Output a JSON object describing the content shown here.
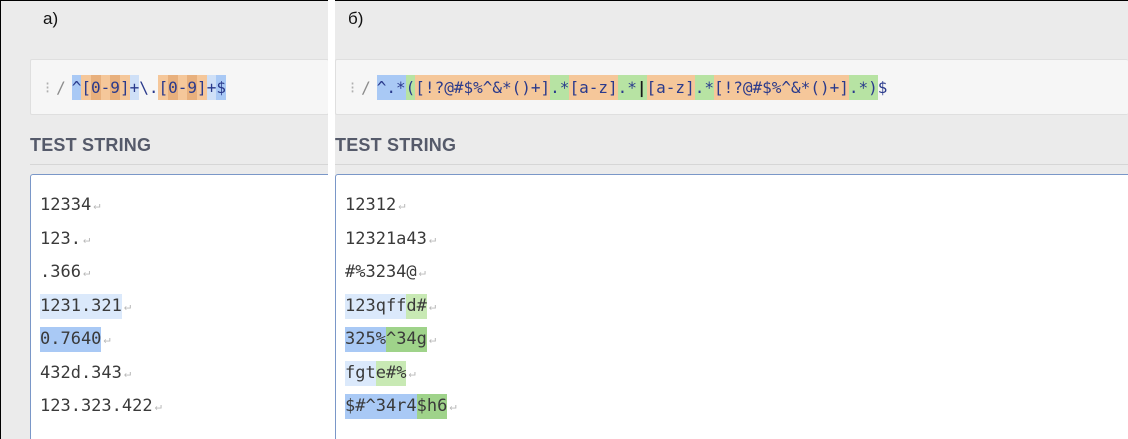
{
  "colors": {
    "panel_bg": "#ebebeb",
    "regex_bar_bg": "#f6f6f6",
    "anchor_blue": "#a9c9f5",
    "group_green": "#b7e3a3",
    "class_orange": "#f5c79a",
    "class_orange_dark": "#e8b07d",
    "quant_blue": "#cfe0f7",
    "match_light_blue": "#dbe9fb",
    "match_blue": "#a9c9f5",
    "match_light_green": "#c8e9b4",
    "match_green": "#9fd38a",
    "box_border": "#7a97c8"
  },
  "icons": [
    "drag-handle-icon",
    "return-icon"
  ],
  "panel_a": {
    "label": "а)",
    "regex_prefix": "/",
    "regex_tokens": [
      {
        "text": "^",
        "style": "anchor"
      },
      {
        "text": "[",
        "style": "class"
      },
      {
        "text": "0",
        "style": "class-lt"
      },
      {
        "text": "-",
        "style": "class"
      },
      {
        "text": "9",
        "style": "class-lt"
      },
      {
        "text": "]",
        "style": "class"
      },
      {
        "text": "+",
        "style": "quant"
      },
      {
        "text": "\\.",
        "style": "plain"
      },
      {
        "text": "[",
        "style": "class"
      },
      {
        "text": "0",
        "style": "class-lt"
      },
      {
        "text": "-",
        "style": "class"
      },
      {
        "text": "9",
        "style": "class-lt"
      },
      {
        "text": "]",
        "style": "class"
      },
      {
        "text": "+",
        "style": "quant"
      },
      {
        "text": "$",
        "style": "anchor"
      }
    ],
    "section_title": "TEST STRING",
    "lines": [
      [
        {
          "text": "12334",
          "hl": "none"
        }
      ],
      [
        {
          "text": "123.",
          "hl": "none"
        }
      ],
      [
        {
          "text": ".366",
          "hl": "none"
        }
      ],
      [
        {
          "text": "1231.321",
          "hl": "light-blue"
        }
      ],
      [
        {
          "text": "0.7640",
          "hl": "blue"
        }
      ],
      [
        {
          "text": "432d.343",
          "hl": "none"
        }
      ],
      [
        {
          "text": "123.323.422",
          "hl": "none"
        }
      ]
    ],
    "return_glyph": "↵"
  },
  "panel_b": {
    "label": "б)",
    "regex_prefix": "/",
    "regex_tokens": [
      {
        "text": "^",
        "style": "anchor"
      },
      {
        "text": ".",
        "style": "anchor"
      },
      {
        "text": "*",
        "style": "anchor"
      },
      {
        "text": "(",
        "style": "group"
      },
      {
        "text": "[!?@#$%^&*()+]",
        "style": "class"
      },
      {
        "text": ".",
        "style": "group"
      },
      {
        "text": "*",
        "style": "group"
      },
      {
        "text": "[a-z]",
        "style": "class"
      },
      {
        "text": ".",
        "style": "group"
      },
      {
        "text": "*",
        "style": "group"
      },
      {
        "text": "|",
        "style": "alt"
      },
      {
        "text": "[a-z]",
        "style": "class"
      },
      {
        "text": ".",
        "style": "group"
      },
      {
        "text": "*",
        "style": "group"
      },
      {
        "text": "[!?@#$%^&*()+]",
        "style": "class"
      },
      {
        "text": ".",
        "style": "group"
      },
      {
        "text": "*",
        "style": "group"
      },
      {
        "text": ")",
        "style": "group"
      },
      {
        "text": "$",
        "style": "plain"
      }
    ],
    "section_title": "TEST STRING",
    "lines": [
      [
        {
          "text": "12312",
          "hl": "none"
        }
      ],
      [
        {
          "text": "12321a43",
          "hl": "none"
        }
      ],
      [
        {
          "text": "#%3234@",
          "hl": "none"
        }
      ],
      [
        {
          "text": "123qff",
          "hl": "light-blue"
        },
        {
          "text": "d#",
          "hl": "light-green"
        }
      ],
      [
        {
          "text": "325%",
          "hl": "blue"
        },
        {
          "text": "^34g",
          "hl": "green"
        }
      ],
      [
        {
          "text": "fgt",
          "hl": "light-blue"
        },
        {
          "text": "e#%",
          "hl": "light-green"
        }
      ],
      [
        {
          "text": "$#^34r4",
          "hl": "blue"
        },
        {
          "text": "$h6",
          "hl": "green"
        }
      ]
    ],
    "return_glyph": "↵"
  }
}
